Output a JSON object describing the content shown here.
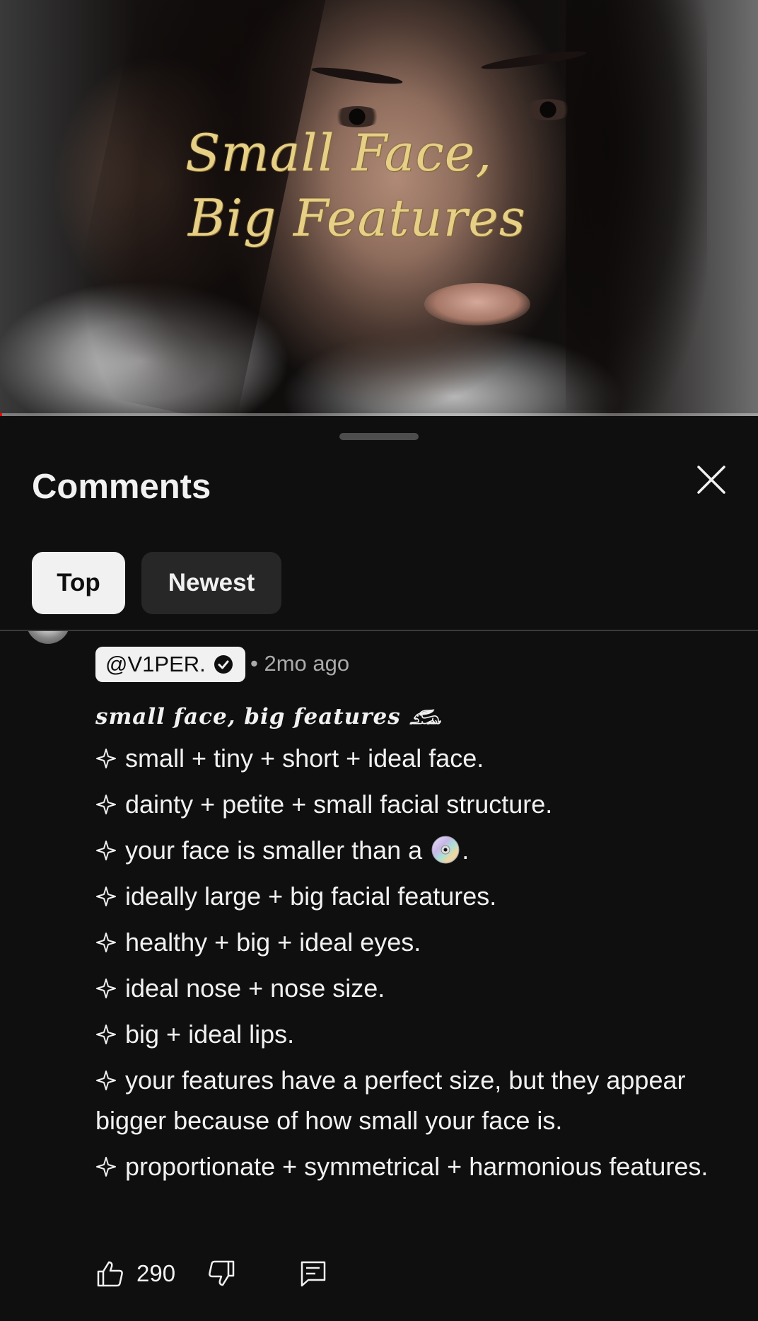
{
  "video": {
    "title_overlay": [
      "Small Face,",
      "Big Features"
    ],
    "progress_fraction": 0.003
  },
  "comments": {
    "heading": "Comments",
    "close_icon": "close-icon",
    "tabs": [
      {
        "label": "Top",
        "selected": true
      },
      {
        "label": "Newest",
        "selected": false
      }
    ],
    "comment": {
      "author": "@V1PER.",
      "verified_icon": "verified-check-icon",
      "meta": "• 2mo ago",
      "fancy_title": "small face, big features 𓃹",
      "lines": [
        "small + tiny + short + ideal face.",
        "dainty + petite + small facial structure.",
        "your face is smaller than a",
        "ideally large + big facial features.",
        "healthy + big + ideal eyes.",
        "ideal nose + nose size.",
        "big + ideal lips.",
        "your features have a perfect size, but they appear bigger because of how small your face is.",
        "proportionate + symmetrical + harmonious features."
      ],
      "line3_suffix": ".",
      "bullet_icon": "sparkle-icon",
      "emoji_icon": "disc-icon",
      "likes": "290"
    }
  },
  "colors": {
    "background": "#0f0f0f",
    "chip_active": "#f1f1f1",
    "chip_inactive": "#272727",
    "title_gold": "#e6cf86",
    "meta_gray": "#aaaaaa"
  }
}
